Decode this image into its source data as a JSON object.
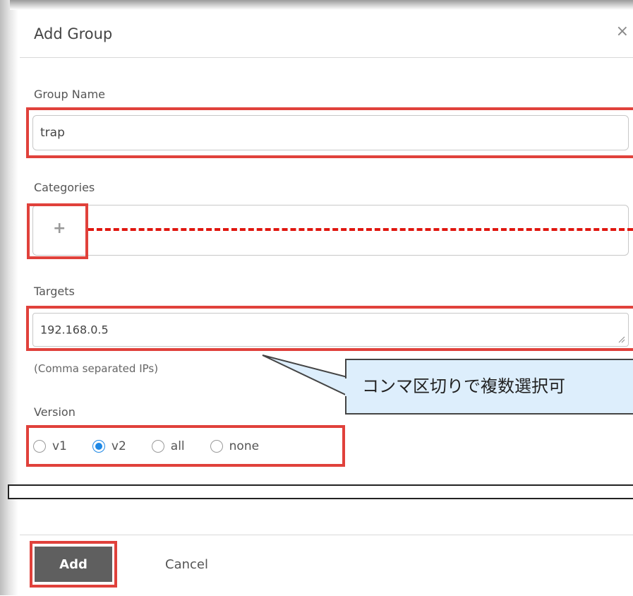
{
  "dialog": {
    "title": "Add Group",
    "close_glyph": "×"
  },
  "group_name": {
    "label": "Group Name",
    "value": "trap"
  },
  "categories": {
    "label": "Categories",
    "add_glyph": "+"
  },
  "targets": {
    "label": "Targets",
    "value": "192.168.0.5",
    "help": "(Comma separated IPs)"
  },
  "version": {
    "label": "Version",
    "options": [
      "v1",
      "v2",
      "all",
      "none"
    ],
    "selected": "v2"
  },
  "annotation": {
    "callout_text": "コンマ区切りで複数選択可"
  },
  "footer": {
    "add_label": "Add",
    "cancel_label": "Cancel"
  },
  "colors": {
    "highlight": "#e0413b",
    "radio_selected": "#1e88e5",
    "primary_button": "#5f5f5f",
    "callout_bg": "#ddeefc"
  }
}
